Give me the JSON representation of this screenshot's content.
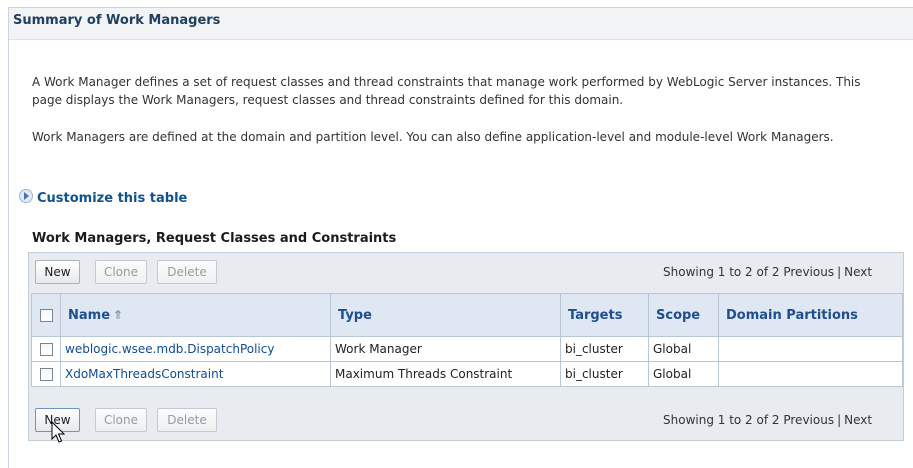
{
  "page": {
    "title": "Summary of Work Managers",
    "description1": "A Work Manager defines a set of request classes and thread constraints that manage work performed by WebLogic Server instances. This page displays the Work Managers, request classes and thread constraints defined for this domain.",
    "description2": "Work Managers are defined at the domain and partition level. You can also define application-level and module-level Work Managers.",
    "customize_link": "Customize this table"
  },
  "table": {
    "title": "Work Managers, Request Classes and Constraints",
    "toolbar": {
      "new_label": "New",
      "clone_label": "Clone",
      "delete_label": "Delete",
      "showing": "Showing 1 to 2 of 2",
      "previous": "Previous",
      "separator": "|",
      "next": "Next"
    },
    "columns": {
      "name": "Name",
      "type": "Type",
      "targets": "Targets",
      "scope": "Scope",
      "partitions": "Domain Partitions"
    },
    "rows": [
      {
        "name": "weblogic.wsee.mdb.DispatchPolicy",
        "type": "Work Manager",
        "targets": "bi_cluster",
        "scope": "Global",
        "partitions": ""
      },
      {
        "name": "XdoMaxThreadsConstraint",
        "type": "Maximum Threads Constraint",
        "targets": "bi_cluster",
        "scope": "Global",
        "partitions": ""
      }
    ]
  },
  "icons": {
    "customize": "expand-triangle-icon",
    "sort": "sort-ascending-icon",
    "cursor": "mouse-pointer-icon"
  },
  "colors": {
    "link": "#124c8c",
    "header_bg": "#dfe8f2",
    "panel_bg": "#e8ecf0"
  }
}
